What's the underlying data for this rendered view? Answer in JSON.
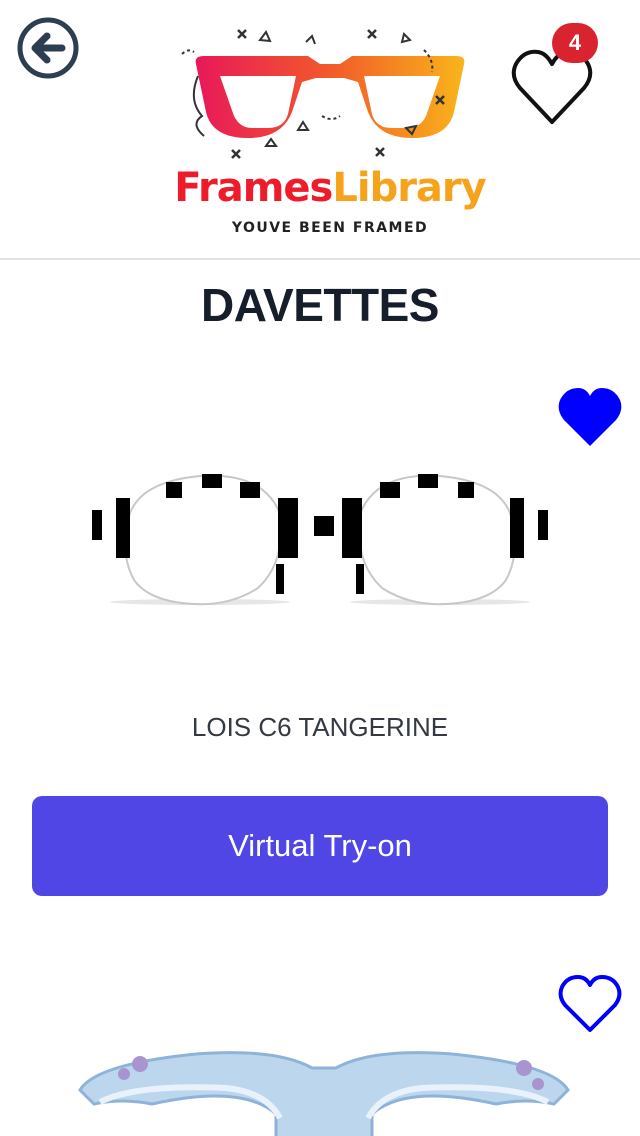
{
  "header": {
    "logo_text_part1": "Frames",
    "logo_text_part2": "Library",
    "tagline": "YOUVE BEEN FRAMED",
    "wishlist_count": "4"
  },
  "page": {
    "title": "DAVETTES"
  },
  "products": [
    {
      "name": "LOIS C6 TANGERINE",
      "action_label": "Virtual Try-on",
      "favorited": true
    },
    {
      "favorited": false
    }
  ],
  "colors": {
    "primary_button": "#4f46e5",
    "favorite_heart": "#0000ff",
    "badge": "#d9232e",
    "logo_red": "#ee1c2b",
    "logo_orange": "#f7a21b"
  },
  "icons": {
    "back": "arrow-left-circle",
    "wishlist": "heart-outline",
    "favorite_active": "heart-filled",
    "favorite_inactive": "heart-outline"
  }
}
